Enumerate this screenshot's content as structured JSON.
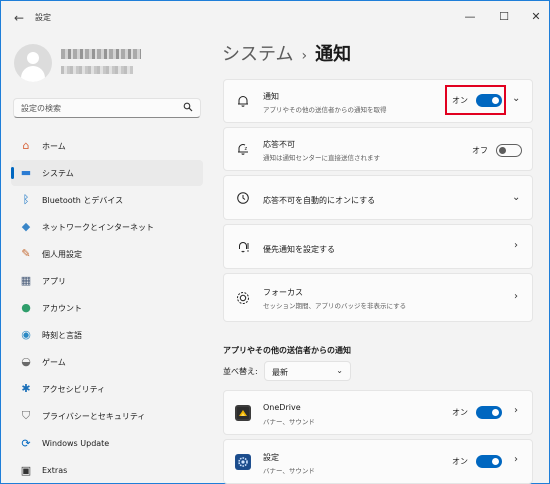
{
  "window": {
    "title": "設定",
    "back_glyph": "←",
    "min_glyph": "—",
    "max_glyph": "☐",
    "close_glyph": "✕"
  },
  "search": {
    "placeholder": "設定の検索",
    "icon": "search-icon"
  },
  "nav": [
    {
      "label": "ホーム",
      "icon": "home-icon",
      "glyph": "⌂",
      "color": "#d8663c"
    },
    {
      "label": "システム",
      "icon": "monitor-icon",
      "glyph": "▬",
      "color": "#2b7cd3",
      "active": true
    },
    {
      "label": "Bluetooth とデバイス",
      "icon": "bluetooth-icon",
      "glyph": "ᛒ",
      "color": "#0067c0"
    },
    {
      "label": "ネットワークとインターネット",
      "icon": "wifi-icon",
      "glyph": "◆",
      "color": "#3a86c8"
    },
    {
      "label": "個人用設定",
      "icon": "brush-icon",
      "glyph": "✎",
      "color": "#c46a32"
    },
    {
      "label": "アプリ",
      "icon": "apps-icon",
      "glyph": "▦",
      "color": "#4a5d7a"
    },
    {
      "label": "アカウント",
      "icon": "account-icon",
      "glyph": "●",
      "color": "#2f9e6b"
    },
    {
      "label": "時刻と言語",
      "icon": "globe-clock-icon",
      "glyph": "◉",
      "color": "#2a89c4"
    },
    {
      "label": "ゲーム",
      "icon": "gamepad-icon",
      "glyph": "◒",
      "color": "#6a6a6a"
    },
    {
      "label": "アクセシビリティ",
      "icon": "accessibility-icon",
      "glyph": "✱",
      "color": "#1a6fb8"
    },
    {
      "label": "プライバシーとセキュリティ",
      "icon": "shield-icon",
      "glyph": "⛉",
      "color": "#6a6a6a"
    },
    {
      "label": "Windows Update",
      "icon": "windows-update-icon",
      "glyph": "⟳",
      "color": "#0067c0"
    },
    {
      "label": "Extras",
      "icon": "extras-icon",
      "glyph": "▣",
      "color": "#333333"
    }
  ],
  "breadcrumb": {
    "parent": "システム",
    "separator": "›",
    "current": "通知"
  },
  "settings": {
    "notifications": {
      "title": "通知",
      "subtitle": "アプリやその他の送信者からの通知を取得",
      "state": "オン",
      "icon": "bell-icon"
    },
    "dnd": {
      "title": "応答不可",
      "subtitle": "通知は通知センターに直接送信されます",
      "state": "オフ",
      "icon": "bell-snooze-icon"
    },
    "dnd_auto": {
      "title": "応答不可を自動的にオンにする",
      "icon": "clock-icon"
    },
    "priority": {
      "title": "優先通知を設定する",
      "icon": "priority-icon"
    },
    "focus": {
      "title": "フォーカス",
      "subtitle": "セッション期間、アプリのバッジを非表示にする",
      "icon": "focus-icon"
    }
  },
  "apps_section": {
    "title": "アプリやその他の送信者からの通知",
    "sort_label": "並べ替え:",
    "sort_value": "最新",
    "apps": [
      {
        "name": "OneDrive",
        "subtitle": "バナー、サウンド",
        "state": "オン",
        "icon": "onedrive-icon"
      },
      {
        "name": "設定",
        "subtitle": "バナー、サウンド",
        "state": "オン",
        "icon": "settings-gear-icon"
      }
    ]
  },
  "colors": {
    "accent": "#0067c0",
    "highlight_border": "#e1001f",
    "window_border": "#1e7ed8"
  }
}
